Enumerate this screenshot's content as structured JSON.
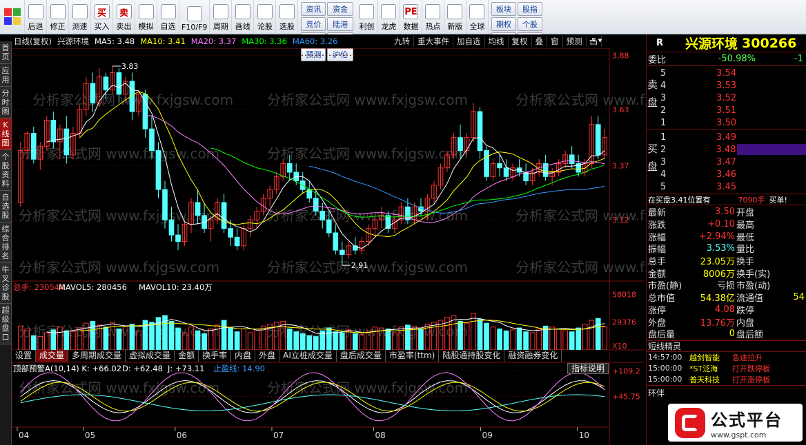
{
  "toolbar": {
    "items": [
      {
        "label": "后退",
        "icon": "back-arrow-icon"
      },
      {
        "label": "修正",
        "icon": "up-down-arrow-icon"
      },
      {
        "label": "测速",
        "icon": "clock-icon"
      },
      {
        "label": "买入",
        "icon": "buy-icon",
        "glyph": "买"
      },
      {
        "label": "卖出",
        "icon": "sell-icon",
        "glyph": "卖"
      },
      {
        "label": "模拟",
        "icon": "gavel-icon"
      },
      {
        "label": "自选",
        "icon": "star-folder-icon"
      },
      {
        "label": "F10/F9",
        "icon": "f10-icon"
      },
      {
        "label": "周期",
        "icon": "period-clock-icon"
      },
      {
        "label": "画线",
        "icon": "pencil-icon"
      },
      {
        "label": "论股",
        "icon": "discuss-icon"
      },
      {
        "label": "选股",
        "icon": "select-stock-icon"
      }
    ],
    "grid_buttons": [
      "资讯",
      "资金",
      "竞价",
      "陆港",
      "研报",
      "BBD",
      "预测",
      "沪伦"
    ],
    "items2": [
      {
        "label": "利创",
        "icon": "chart-icon"
      },
      {
        "label": "龙虎",
        "icon": "dragon-icon"
      },
      {
        "label": "数据",
        "icon": "pe-icon",
        "glyph": "PE"
      },
      {
        "label": "热点",
        "icon": "hot-icon"
      },
      {
        "label": "新版",
        "icon": "new-version-icon"
      },
      {
        "label": "全球",
        "icon": "globe-icon"
      }
    ],
    "right_buttons": [
      "板块",
      "股指",
      "期权",
      "个股",
      "指数",
      "期货"
    ]
  },
  "left_tabs": [
    {
      "label": "首页",
      "active": false
    },
    {
      "label": "应用",
      "active": false
    },
    {
      "label": "分时图",
      "active": false
    },
    {
      "label": "K线图",
      "active": true
    },
    {
      "label": "个股资料",
      "active": false
    },
    {
      "label": "自选股",
      "active": false
    },
    {
      "label": "综合排名",
      "active": false
    },
    {
      "label": "牛叉诊股",
      "active": false
    },
    {
      "label": "超级盘口",
      "active": false
    }
  ],
  "chart_header": {
    "period": "日线(复权)",
    "name": "兴源环境",
    "ma5": "MA5: 3.48",
    "ma10": "MA10: 3.41",
    "ma20": "MA20: 3.37",
    "ma30": "MA30: 3.36",
    "ma60": "MA60: 3.26",
    "buttons": [
      "九转",
      "重大事件",
      "加自选",
      "均线",
      "复权",
      "叠",
      "窗",
      "预测",
      "凸"
    ]
  },
  "colors": {
    "up": "#ff3333",
    "down": "#54ffff",
    "ma5": "#ffffff",
    "ma10": "#ffff00",
    "ma20": "#ff80ff",
    "ma30": "#00ff00",
    "ma60": "#3399ff",
    "grid": "#7a1010"
  },
  "chart_data": [
    {
      "type": "candlestick",
      "title": "日线(复权)",
      "y_ticks": [
        "3.88",
        "3.63",
        "3.37",
        "3.12"
      ],
      "y_range": [
        2.85,
        3.9
      ],
      "annotations": [
        {
          "label": "3.83",
          "note": "high"
        },
        {
          "label": "2.91",
          "note": "low"
        }
      ],
      "x_month_labels": [
        "04",
        "05",
        "06",
        "07",
        "08",
        "09",
        "10"
      ],
      "series": [
        {
          "name": "K线",
          "values": [
            [
              3.2,
              3.48,
              3.18,
              3.44
            ],
            [
              3.44,
              3.53,
              3.4,
              3.52
            ],
            [
              3.52,
              3.55,
              3.38,
              3.4
            ],
            [
              3.4,
              3.48,
              3.35,
              3.46
            ],
            [
              3.46,
              3.6,
              3.44,
              3.58
            ],
            [
              3.58,
              3.62,
              3.45,
              3.48
            ],
            [
              3.48,
              3.56,
              3.4,
              3.54
            ],
            [
              3.54,
              3.6,
              3.38,
              3.42
            ],
            [
              3.42,
              3.55,
              3.4,
              3.52
            ],
            [
              3.52,
              3.65,
              3.5,
              3.63
            ],
            [
              3.63,
              3.78,
              3.6,
              3.75
            ],
            [
              3.75,
              3.8,
              3.62,
              3.66
            ],
            [
              3.66,
              3.82,
              3.64,
              3.78
            ],
            [
              3.78,
              3.8,
              3.68,
              3.72
            ],
            [
              3.72,
              3.83,
              3.7,
              3.8
            ],
            [
              3.8,
              3.82,
              3.66,
              3.7
            ],
            [
              3.7,
              3.78,
              3.66,
              3.76
            ],
            [
              3.76,
              3.8,
              3.58,
              3.62
            ],
            [
              3.62,
              3.72,
              3.6,
              3.7
            ],
            [
              3.7,
              3.72,
              3.5,
              3.54
            ],
            [
              3.54,
              3.6,
              3.4,
              3.44
            ],
            [
              3.44,
              3.48,
              3.22,
              3.26
            ],
            [
              3.26,
              3.3,
              3.08,
              3.12
            ],
            [
              3.12,
              3.18,
              3.02,
              3.05
            ],
            [
              3.05,
              3.1,
              2.98,
              3.02
            ],
            [
              3.02,
              3.12,
              3.0,
              3.1
            ],
            [
              3.1,
              3.22,
              3.06,
              3.2
            ],
            [
              3.2,
              3.26,
              3.1,
              3.14
            ],
            [
              3.14,
              3.2,
              3.06,
              3.08
            ],
            [
              3.08,
              3.14,
              3.02,
              3.12
            ],
            [
              3.12,
              3.22,
              3.1,
              3.2
            ],
            [
              3.2,
              3.24,
              3.06,
              3.08
            ],
            [
              3.08,
              3.12,
              3.0,
              3.04
            ],
            [
              3.04,
              3.08,
              2.98,
              3.0
            ],
            [
              3.0,
              3.1,
              2.98,
              3.08
            ],
            [
              3.08,
              3.14,
              3.04,
              3.12
            ],
            [
              3.12,
              3.18,
              3.08,
              3.16
            ],
            [
              3.16,
              3.24,
              3.14,
              3.22
            ],
            [
              3.22,
              3.28,
              3.18,
              3.26
            ],
            [
              3.26,
              3.34,
              3.24,
              3.32
            ],
            [
              3.32,
              3.4,
              3.3,
              3.38
            ],
            [
              3.38,
              3.42,
              3.3,
              3.34
            ],
            [
              3.34,
              3.38,
              3.28,
              3.3
            ],
            [
              3.3,
              3.34,
              3.24,
              3.26
            ],
            [
              3.26,
              3.3,
              3.2,
              3.22
            ],
            [
              3.22,
              3.26,
              3.14,
              3.16
            ],
            [
              3.16,
              3.2,
              3.08,
              3.12
            ],
            [
              3.12,
              3.16,
              3.04,
              3.06
            ],
            [
              3.06,
              3.1,
              2.96,
              2.98
            ],
            [
              2.98,
              3.02,
              2.91,
              2.96
            ],
            [
              2.96,
              3.02,
              2.94,
              3.0
            ],
            [
              3.0,
              3.04,
              2.96,
              2.98
            ],
            [
              2.98,
              3.04,
              2.96,
              3.02
            ],
            [
              3.02,
              3.1,
              3.0,
              3.08
            ],
            [
              3.08,
              3.14,
              3.04,
              3.12
            ],
            [
              3.12,
              3.18,
              3.08,
              3.14
            ],
            [
              3.14,
              3.16,
              3.06,
              3.08
            ],
            [
              3.08,
              3.14,
              3.06,
              3.12
            ],
            [
              3.12,
              3.2,
              3.1,
              3.18
            ],
            [
              3.18,
              3.22,
              3.1,
              3.12
            ],
            [
              3.12,
              3.2,
              3.1,
              3.18
            ],
            [
              3.18,
              3.22,
              3.14,
              3.16
            ],
            [
              3.16,
              3.24,
              3.12,
              3.22
            ],
            [
              3.22,
              3.3,
              3.2,
              3.28
            ],
            [
              3.28,
              3.38,
              3.26,
              3.36
            ],
            [
              3.36,
              3.44,
              3.34,
              3.42
            ],
            [
              3.42,
              3.52,
              3.4,
              3.5
            ],
            [
              3.5,
              3.56,
              3.4,
              3.44
            ],
            [
              3.44,
              3.52,
              3.42,
              3.5
            ],
            [
              3.5,
              3.66,
              3.48,
              3.62
            ],
            [
              3.62,
              3.64,
              3.4,
              3.44
            ],
            [
              3.44,
              3.46,
              3.3,
              3.32
            ],
            [
              3.32,
              3.4,
              3.3,
              3.38
            ],
            [
              3.38,
              3.42,
              3.32,
              3.36
            ],
            [
              3.36,
              3.4,
              3.3,
              3.32
            ],
            [
              3.32,
              3.38,
              3.3,
              3.36
            ],
            [
              3.36,
              3.4,
              3.32,
              3.34
            ],
            [
              3.34,
              3.38,
              3.28,
              3.3
            ],
            [
              3.3,
              3.36,
              3.28,
              3.34
            ],
            [
              3.34,
              3.4,
              3.32,
              3.38
            ],
            [
              3.38,
              3.42,
              3.3,
              3.32
            ],
            [
              3.32,
              3.36,
              3.28,
              3.34
            ],
            [
              3.34,
              3.4,
              3.32,
              3.38
            ],
            [
              3.38,
              3.44,
              3.36,
              3.42
            ],
            [
              3.42,
              3.46,
              3.36,
              3.38
            ],
            [
              3.38,
              3.42,
              3.32,
              3.34
            ],
            [
              3.34,
              3.4,
              3.32,
              3.38
            ],
            [
              3.38,
              3.6,
              3.36,
              3.56
            ],
            [
              3.56,
              3.6,
              3.4,
              3.42
            ],
            [
              3.42,
              3.54,
              3.4,
              3.5
            ]
          ]
        },
        {
          "name": "MA5",
          "color": "#ffffff"
        },
        {
          "name": "MA10",
          "color": "#ffff00"
        },
        {
          "name": "MA20",
          "color": "#ff80ff"
        },
        {
          "name": "MA30",
          "color": "#00ff00"
        },
        {
          "name": "MA60",
          "color": "#3399ff"
        }
      ]
    },
    {
      "type": "bar",
      "title": "总手",
      "legend": [
        "总手: 230544",
        "MAVOL5: 280456",
        "MAVOL10: 23.40万"
      ],
      "y_ticks": [
        "58018",
        "29376"
      ],
      "y_unit": "X10",
      "y_range": [
        0,
        62000
      ],
      "values": [
        25000,
        22000,
        15000,
        14000,
        18000,
        21000,
        24000,
        20000,
        19000,
        23000,
        28000,
        30000,
        26000,
        24000,
        29000,
        22000,
        25000,
        27000,
        20000,
        31000,
        29000,
        34000,
        36000,
        30000,
        23000,
        18000,
        24000,
        20000,
        17000,
        22000,
        26000,
        31000,
        23000,
        19000,
        22000,
        18000,
        21000,
        25000,
        27000,
        29000,
        30000,
        22000,
        19000,
        17000,
        15000,
        14000,
        20000,
        23000,
        19000,
        18000,
        21000,
        17000,
        16000,
        20000,
        24000,
        23000,
        22000,
        18000,
        24000,
        26000,
        25000,
        22000,
        27000,
        29000,
        31000,
        34000,
        36000,
        30000,
        28000,
        38000,
        32000,
        28000,
        24000,
        22000,
        20000,
        21000,
        23000,
        19000,
        18000,
        22000,
        25000,
        24000,
        22000,
        20000,
        19000,
        23000,
        27000,
        31000,
        33000,
        24000
      ]
    },
    {
      "type": "line",
      "title": "顶部预警A(10,14)",
      "legend": [
        "K: +66.02",
        "D: +62.48",
        "J: +73.11",
        "止盈线: 14.90"
      ],
      "y_ticks": [
        "+109.2",
        "+45.75"
      ],
      "y_range": [
        -20,
        120
      ]
    }
  ],
  "sub_tabs": [
    {
      "label": "设置",
      "active": false
    },
    {
      "label": "成交量",
      "active": true
    },
    {
      "label": "多周期成交量",
      "active": false
    },
    {
      "label": "虚拟成交量",
      "active": false
    },
    {
      "label": "金额",
      "active": false
    },
    {
      "label": "换手率",
      "active": false
    },
    {
      "label": "内盘",
      "active": false
    },
    {
      "label": "外盘",
      "active": false
    },
    {
      "label": "AI立桩成交量",
      "active": false
    },
    {
      "label": "盘后成交量",
      "active": false
    },
    {
      "label": "市盈率(ttm)",
      "active": false
    },
    {
      "label": "陆股通持股变化",
      "active": false
    },
    {
      "label": "融资融券变化",
      "active": false
    }
  ],
  "indicator_button": "指标说明",
  "watermark": "分析家公式网 www.fxjgsw.com",
  "quote": {
    "tag": "R",
    "name": "兴源环境",
    "code": "300266",
    "weibi_label": "委比",
    "weibi_value": "-50.98%",
    "weibi_extra": "-1",
    "sell_label": "卖盘",
    "buy_label": "买盘",
    "sells": [
      {
        "n": "5",
        "p": "3.54"
      },
      {
        "n": "4",
        "p": "3.53"
      },
      {
        "n": "3",
        "p": "3.52"
      },
      {
        "n": "2",
        "p": "3.51"
      },
      {
        "n": "1",
        "p": "3.50"
      }
    ],
    "buys": [
      {
        "n": "1",
        "p": "3.49"
      },
      {
        "n": "2",
        "p": "3.48"
      },
      {
        "n": "3",
        "p": "3.47"
      },
      {
        "n": "4",
        "p": "3.46"
      },
      {
        "n": "5",
        "p": "3.45"
      }
    ],
    "order_note": "在买盘3.41位置有",
    "order_qty": "7090手",
    "order_tag": "买单!",
    "stats": [
      {
        "l": "最新",
        "v": "3.50",
        "c": "#ff3333",
        "l2": "开盘"
      },
      {
        "l": "涨跌",
        "v": "+0.10",
        "c": "#ff3333",
        "l2": "最高"
      },
      {
        "l": "涨幅",
        "v": "+2.94%",
        "c": "#ff3333",
        "l2": "最低"
      },
      {
        "l": "振幅",
        "v": "3.53%",
        "c": "#54ffff",
        "l2": "量比"
      },
      {
        "l": "总手",
        "v": "23.05万",
        "c": "#ffff00",
        "l2": "换手"
      },
      {
        "l": "金额",
        "v": "8006万",
        "c": "#ffff00",
        "l2": "换手(实)"
      },
      {
        "l": "市盈(静)",
        "v": "亏损",
        "c": "#dddddd",
        "l2": "市盈(动)"
      },
      {
        "l": "总市值",
        "v": "54.38亿",
        "c": "#ffff00",
        "l2": "流通值"
      },
      {
        "l": "涨停",
        "v": "4.08",
        "c": "#ff3333",
        "l2": "跌停"
      },
      {
        "l": "外盘",
        "v": "13.76万",
        "c": "#ff3333",
        "l2": "内盘"
      },
      {
        "l": "盘后量",
        "v": "0",
        "c": "#ffff00",
        "l2": "盘后额"
      }
    ],
    "flow_extra": "54",
    "short_title": "短线精灵",
    "short_items": [
      {
        "t": "14:57:00",
        "n": "越剑智能",
        "e": "急速拉升"
      },
      {
        "t": "15:00:00",
        "n": "*ST泛海",
        "e": "打开跌停板"
      },
      {
        "t": "15:00:00",
        "n": "普天科技",
        "e": "打开涨停板"
      }
    ],
    "bottom_label": "环伴"
  },
  "logo": {
    "brand": "公式平台",
    "url": "www.gspt.com"
  }
}
